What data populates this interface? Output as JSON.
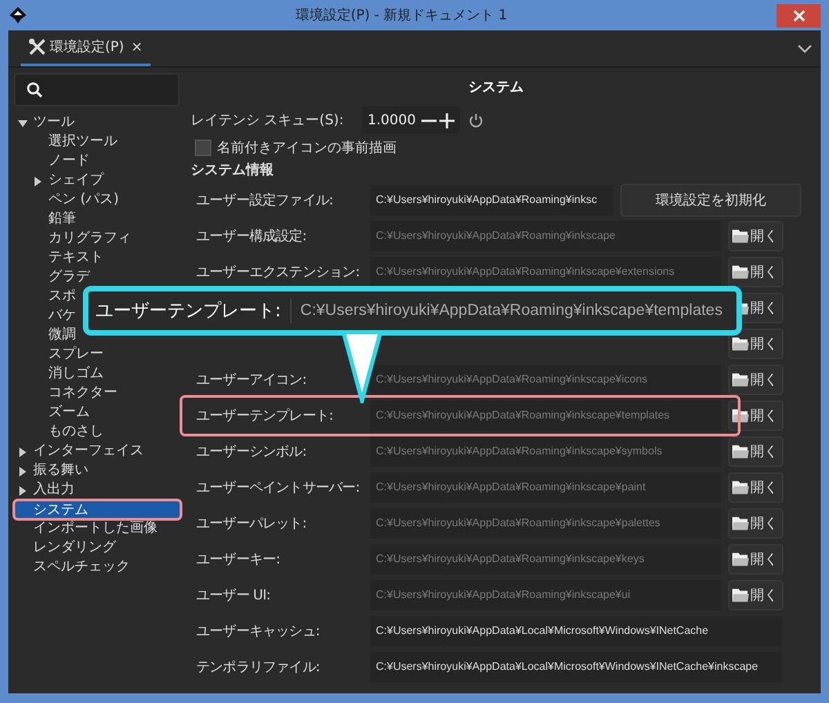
{
  "window": {
    "title": "環境設定(P) - 新規ドキュメント 1"
  },
  "tabs": [
    {
      "label": "環境設定(P)",
      "close": "×",
      "selected": true
    }
  ],
  "sidebar": {
    "items": [
      {
        "label": "ツール",
        "expanded": true,
        "selected": false,
        "children": [
          {
            "label": "選択ツール",
            "selected": false
          },
          {
            "label": "ノード",
            "selected": false
          },
          {
            "label": "シェイプ",
            "expanded": false,
            "selected": false
          },
          {
            "label": "ペン (パス)",
            "selected": false
          },
          {
            "label": "鉛筆",
            "selected": false
          },
          {
            "label": "カリグラフィ",
            "selected": false
          },
          {
            "label": "テキスト",
            "selected": false
          },
          {
            "label": "グラデ",
            "selected": false
          },
          {
            "label": "スポ",
            "selected": false
          },
          {
            "label": "バケ",
            "selected": false
          },
          {
            "label": "微調",
            "selected": false
          },
          {
            "label": "スプレー",
            "selected": false
          },
          {
            "label": "消しゴム",
            "selected": false
          },
          {
            "label": "コネクター",
            "selected": false
          },
          {
            "label": "ズーム",
            "selected": false
          },
          {
            "label": "ものさし",
            "selected": false
          }
        ]
      },
      {
        "label": "インターフェイス",
        "expanded": false,
        "selected": false
      },
      {
        "label": "振る舞い",
        "expanded": false,
        "selected": false
      },
      {
        "label": "入出力",
        "expanded": false,
        "selected": false
      },
      {
        "label": "システム",
        "selected": true
      },
      {
        "label": "インポートした画像",
        "selected": false
      },
      {
        "label": "レンダリング",
        "selected": false
      },
      {
        "label": "スペルチェック",
        "selected": false
      }
    ]
  },
  "panel": {
    "title": "システム",
    "latency": {
      "label": "レイテンシ スキュー(S):",
      "value": "1.0000"
    },
    "checkbox": {
      "label": "名前付きアイコンの事前描画",
      "checked": false
    },
    "section": "システム情報",
    "rows": [
      {
        "label": "ユーザー設定ファイル:",
        "path": "C:¥Users¥hiroyuki¥AppData¥Roaming¥inksc",
        "disabled": false,
        "button": "環境設定を初期化",
        "kind": "reset"
      },
      {
        "label": "ユーザー構成設定:",
        "path": "C:¥Users¥hiroyuki¥AppData¥Roaming¥inkscape",
        "disabled": true,
        "button": "開く",
        "kind": "open"
      },
      {
        "label": "ユーザーエクステンション:",
        "path": "C:¥Users¥hiroyuki¥AppData¥Roaming¥inkscape¥extensions",
        "disabled": true,
        "button": "開く",
        "kind": "open"
      },
      {
        "button": "開く",
        "kind": "open"
      },
      {
        "button": "開く",
        "kind": "open"
      },
      {
        "label": "ユーザーアイコン:",
        "path": "C:¥Users¥hiroyuki¥AppData¥Roaming¥inkscape¥icons",
        "disabled": true,
        "button": "開く",
        "kind": "open"
      },
      {
        "label": "ユーザーテンプレート:",
        "path": "C:¥Users¥hiroyuki¥AppData¥Roaming¥inkscape¥templates",
        "disabled": true,
        "button": "開く",
        "kind": "open",
        "highlighted": true
      },
      {
        "label": "ユーザーシンボル:",
        "path": "C:¥Users¥hiroyuki¥AppData¥Roaming¥inkscape¥symbols",
        "disabled": true,
        "button": "開く",
        "kind": "open"
      },
      {
        "label": "ユーザーペイントサーバー:",
        "path": "C:¥Users¥hiroyuki¥AppData¥Roaming¥inkscape¥paint",
        "disabled": true,
        "button": "開く",
        "kind": "open"
      },
      {
        "label": "ユーザーパレット:",
        "path": "C:¥Users¥hiroyuki¥AppData¥Roaming¥inkscape¥palettes",
        "disabled": true,
        "button": "開く",
        "kind": "open"
      },
      {
        "label": "ユーザーキー:",
        "path": "C:¥Users¥hiroyuki¥AppData¥Roaming¥inkscape¥keys",
        "disabled": true,
        "button": "開く",
        "kind": "open"
      },
      {
        "label": "ユーザー UI:",
        "path": "C:¥Users¥hiroyuki¥AppData¥Roaming¥inkscape¥ui",
        "disabled": true,
        "button": "開く",
        "kind": "open"
      },
      {
        "label": "ユーザーキャッシュ:",
        "path": "C:¥Users¥hiroyuki¥AppData¥Local¥Microsoft¥Windows¥INetCache",
        "disabled": false
      },
      {
        "label": "テンポラリファイル:",
        "path": "C:¥Users¥hiroyuki¥AppData¥Local¥Microsoft¥Windows¥INetCache¥inkscape",
        "disabled": false
      }
    ]
  },
  "callout": {
    "label": "ユーザーテンプレート:",
    "path": "C:¥Users¥hiroyuki¥AppData¥Roaming¥inkscape¥templates"
  }
}
